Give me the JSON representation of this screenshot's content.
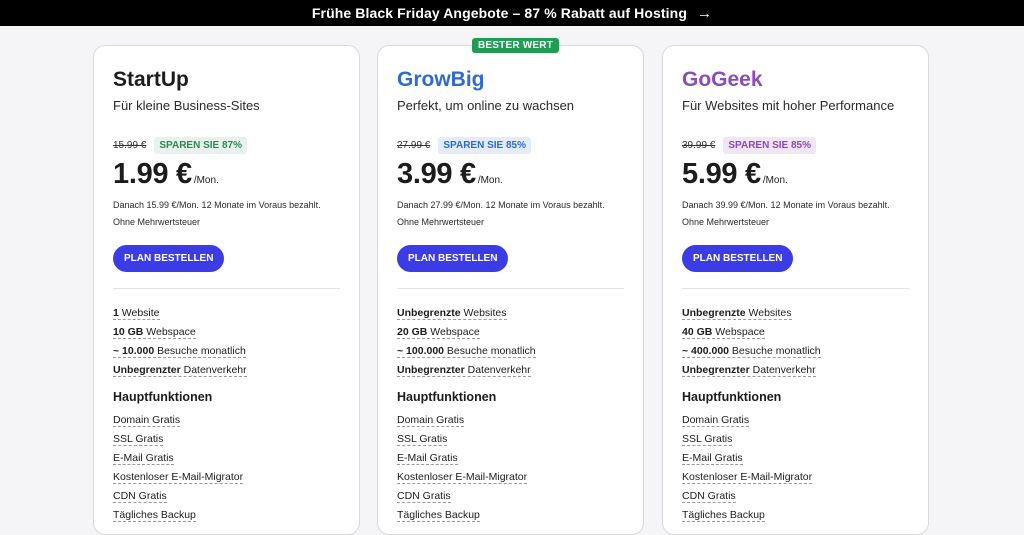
{
  "banner": {
    "text": "Frühe Black Friday Angebote – 87 % Rabatt auf Hosting",
    "arrow": "→"
  },
  "plans": [
    {
      "name": "StartUp",
      "desc": "Für kleine Business-Sites",
      "old_price": "15.99 €",
      "save": "SPAREN SIE 87%",
      "price": "1.99 €",
      "per": "/Mon.",
      "note": "Danach 15.99 €/Mon. 12 Monate im Voraus bezahlt. Ohne Mehrwertsteuer",
      "button": "PLAN BESTELLEN",
      "specs": [
        {
          "bold": "1",
          "rest": " Website"
        },
        {
          "bold": "10 GB",
          "rest": " Webspace"
        },
        {
          "bold": "~ 10.000",
          "rest": " Besuche monatlich"
        },
        {
          "bold": "Unbegrenzter",
          "rest": " Datenverkehr"
        }
      ],
      "section": "Hauptfunktionen",
      "features": [
        "Domain Gratis",
        "SSL Gratis",
        "E-Mail Gratis",
        "Kostenloser E-Mail-Migrator",
        "CDN Gratis",
        "Tägliches Backup"
      ]
    },
    {
      "name": "GrowBig",
      "badge": "BESTER WERT",
      "desc": "Perfekt, um online zu wachsen",
      "old_price": "27.99 €",
      "save": "SPAREN SIE 85%",
      "price": "3.99 €",
      "per": "/Mon.",
      "note": "Danach 27.99 €/Mon. 12 Monate im Voraus bezahlt. Ohne Mehrwertsteuer",
      "button": "PLAN BESTELLEN",
      "specs": [
        {
          "bold": "Unbegrenzte",
          "rest": " Websites"
        },
        {
          "bold": "20 GB",
          "rest": " Webspace"
        },
        {
          "bold": "~ 100.000",
          "rest": " Besuche monatlich"
        },
        {
          "bold": "Unbegrenzter",
          "rest": " Datenverkehr"
        }
      ],
      "section": "Hauptfunktionen",
      "features": [
        "Domain Gratis",
        "SSL Gratis",
        "E-Mail Gratis",
        "Kostenloser E-Mail-Migrator",
        "CDN Gratis",
        "Tägliches Backup"
      ]
    },
    {
      "name": "GoGeek",
      "desc": "Für Websites mit hoher Performance",
      "old_price": "39.99 €",
      "save": "SPAREN SIE 85%",
      "price": "5.99 €",
      "per": "/Mon.",
      "note": "Danach 39.99 €/Mon. 12 Monate im Voraus bezahlt. Ohne Mehrwertsteuer",
      "button": "PLAN BESTELLEN",
      "specs": [
        {
          "bold": "Unbegrenzte",
          "rest": " Websites"
        },
        {
          "bold": "40 GB",
          "rest": " Webspace"
        },
        {
          "bold": "~ 400.000",
          "rest": " Besuche monatlich"
        },
        {
          "bold": "Unbegrenzter",
          "rest": " Datenverkehr"
        }
      ],
      "section": "Hauptfunktionen",
      "features": [
        "Domain Gratis",
        "SSL Gratis",
        "E-Mail Gratis",
        "Kostenloser E-Mail-Migrator",
        "CDN Gratis",
        "Tägliches Backup"
      ]
    }
  ],
  "colors": {
    "button": "#3b3ce6",
    "best_badge": "#1f9d55",
    "growbig": "#2d6bcf",
    "gogeek": "#8c4bbd"
  }
}
